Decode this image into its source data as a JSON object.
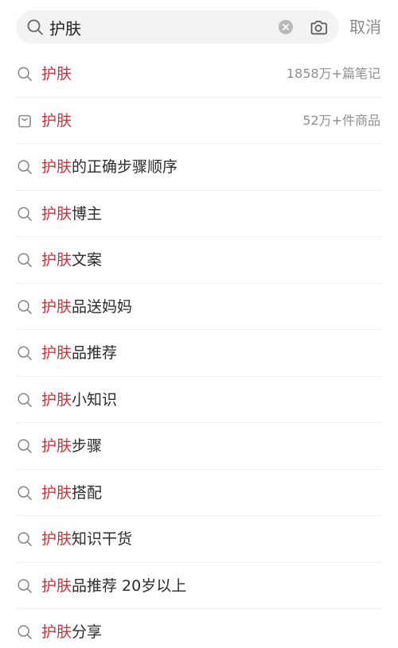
{
  "search": {
    "query": "护肤",
    "cancel_label": "取消"
  },
  "colors": {
    "highlight": "#c7333a",
    "text": "#2b2b2b",
    "meta": "#8e8e92",
    "search_bg": "#f3f3f5"
  },
  "suggestions": [
    {
      "icon": "search-icon",
      "keyword": "护肤",
      "rest": "",
      "meta": "1858万+篇笔记"
    },
    {
      "icon": "shopping-bag-icon",
      "keyword": "护肤",
      "rest": "",
      "meta": "52万+件商品"
    },
    {
      "icon": "search-icon",
      "keyword": "护肤",
      "rest": "的正确步骤顺序",
      "meta": ""
    },
    {
      "icon": "search-icon",
      "keyword": "护肤",
      "rest": "博主",
      "meta": ""
    },
    {
      "icon": "search-icon",
      "keyword": "护肤",
      "rest": "文案",
      "meta": ""
    },
    {
      "icon": "search-icon",
      "keyword": "护肤",
      "rest": "品送妈妈",
      "meta": ""
    },
    {
      "icon": "search-icon",
      "keyword": "护肤",
      "rest": "品推荐",
      "meta": ""
    },
    {
      "icon": "search-icon",
      "keyword": "护肤",
      "rest": "小知识",
      "meta": ""
    },
    {
      "icon": "search-icon",
      "keyword": "护肤",
      "rest": "步骤",
      "meta": ""
    },
    {
      "icon": "search-icon",
      "keyword": "护肤",
      "rest": "搭配",
      "meta": ""
    },
    {
      "icon": "search-icon",
      "keyword": "护肤",
      "rest": "知识干货",
      "meta": ""
    },
    {
      "icon": "search-icon",
      "keyword": "护肤",
      "rest": "品推荐 20岁以上",
      "meta": ""
    },
    {
      "icon": "search-icon",
      "keyword": "护肤",
      "rest": "分享",
      "meta": ""
    }
  ]
}
